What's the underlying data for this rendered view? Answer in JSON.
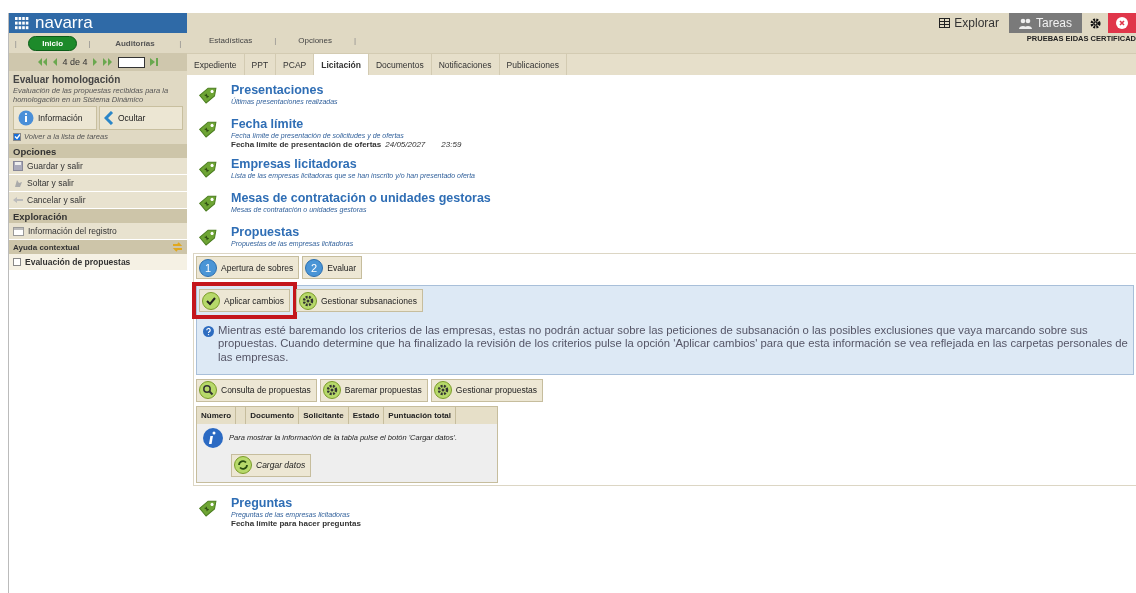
{
  "logo": {
    "text": "navarra"
  },
  "top_nav": {
    "separator": "|",
    "items": [
      {
        "label": "Inicio",
        "selected": true
      },
      {
        "label": "Auditorías",
        "selected": false
      }
    ]
  },
  "pager": {
    "text": "4 de 4"
  },
  "task": {
    "title": "Evaluar homologación",
    "description": "Evaluación de las propuestas recibidas para la homologación en un Sistema Dinámico",
    "buttons": [
      {
        "label": "Información",
        "kind": "info"
      },
      {
        "label": "Ocultar",
        "kind": "back"
      }
    ],
    "return_checkbox": {
      "label": "Volver a la lista de tareas",
      "checked": true
    }
  },
  "sidebar_sections": [
    {
      "title": "Opciones",
      "kind": "header",
      "items": [
        {
          "label": "Guardar y salir",
          "kind": "save"
        },
        {
          "label": "Soltar y salir",
          "kind": "release"
        },
        {
          "label": "Cancelar y salir",
          "kind": "cancel"
        }
      ]
    },
    {
      "title": "Exploración",
      "kind": "header",
      "items": [
        {
          "label": "Información del registro",
          "kind": "record"
        }
      ]
    },
    {
      "title": "Ayuda contextual",
      "kind": "help",
      "items": [
        {
          "label": "Evaluación de propuestas",
          "kind": "checkbox",
          "checked": false
        }
      ]
    }
  ],
  "top_actions": [
    {
      "label": "Explorar",
      "kind": "grid",
      "selected": false
    },
    {
      "label": "Tareas",
      "kind": "users",
      "selected": true
    }
  ],
  "user": "PRUEBAS EIDAS CERTIFICAD",
  "menu": {
    "separator": "|",
    "items": [
      "Estadísticas",
      "Opciones"
    ]
  },
  "tabs": [
    {
      "label": "Expediente",
      "selected": false
    },
    {
      "label": "PPT",
      "selected": false
    },
    {
      "label": "PCAP",
      "selected": false
    },
    {
      "label": "Licitación",
      "selected": true
    },
    {
      "label": "Documentos",
      "selected": false
    },
    {
      "label": "Notificaciones",
      "selected": false
    },
    {
      "label": "Publicaciones",
      "selected": false
    }
  ],
  "sections": [
    {
      "title": "Presentaciones",
      "subtitle": "Últimas presentaciones realizadas"
    },
    {
      "title": "Fecha límite",
      "subtitle": "Fecha límite de presentación de solicitudes y de ofertas",
      "details": [
        {
          "label": "Fecha límite de presentación de ofertas",
          "value": "24/05/2027",
          "time": "23:59"
        }
      ]
    },
    {
      "title": "Empresas licitadoras",
      "subtitle": "Lista de las empresas licitadoras que se han inscrito y/o han presentado oferta"
    },
    {
      "title": "Mesas de contratación o unidades gestoras",
      "subtitle": "Mesas de contratación o unidades gestoras"
    },
    {
      "title": "Propuestas",
      "subtitle": "Propuestas de las empresas licitadoras",
      "panel": {
        "steps": [
          {
            "number": "1",
            "label": "Apertura de sobres"
          },
          {
            "number": "2",
            "label": "Evaluar"
          }
        ],
        "actions": [
          {
            "label": "Aplicar cambios",
            "kind": "check",
            "highlighted": true
          },
          {
            "label": "Gestionar subsanaciones",
            "kind": "gear",
            "highlighted": false
          }
        ],
        "notice": "Mientras esté baremando los criterios de las empresas, estas no podrán actuar sobre las peticiones de subsanación o las posibles exclusiones que vaya marcando sobre sus propuestas. Cuando determine que ha finalizado la revisión de los criterios pulse la opción 'Aplicar cambios' para que esta información se vea reflejada en las carpetas personales de las empresas.",
        "tools": [
          {
            "label": "Consulta de propuestas",
            "kind": "search"
          },
          {
            "label": "Baremar propuestas",
            "kind": "gear"
          },
          {
            "label": "Gestionar propuestas",
            "kind": "gear"
          }
        ],
        "table": {
          "columns": [
            "Número",
            "Documento",
            "Solicitante",
            "Estado",
            "Puntuación total"
          ],
          "message": "Para mostrar la información de la tabla pulse el botón 'Cargar datos'.",
          "load_button": "Cargar datos"
        }
      }
    },
    {
      "title": "Preguntas",
      "subtitle": "Preguntas de las empresas licitadoras",
      "details": [
        {
          "label": "Fecha límite para hacer preguntas"
        }
      ]
    }
  ]
}
